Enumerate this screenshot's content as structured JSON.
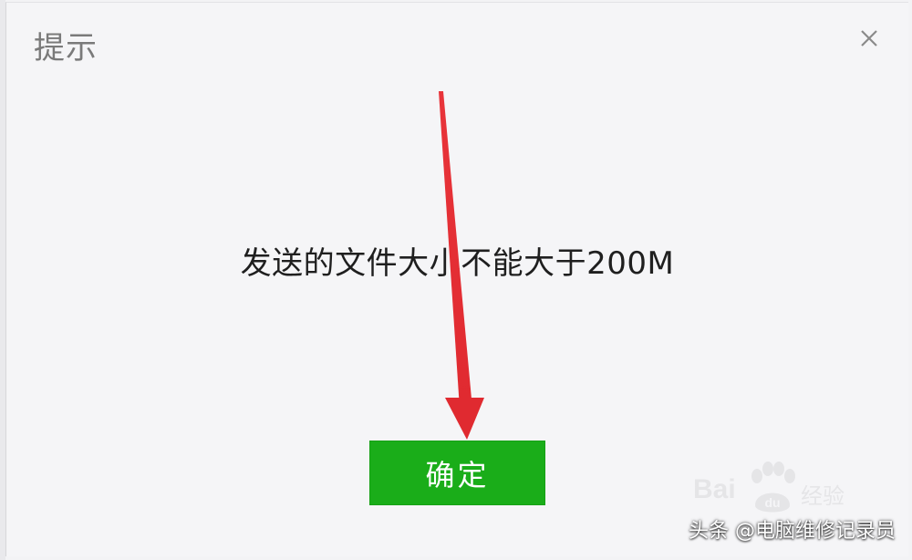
{
  "dialog": {
    "title": "提示",
    "message": "发送的文件大小不能大于200M",
    "confirm_label": "确定",
    "close_icon": "close-icon"
  },
  "watermark": {
    "brand_text": "Bai",
    "brand_suffix": "经验"
  },
  "credit": {
    "text": "头条 @电脑维修记录员"
  },
  "colors": {
    "confirm_bg": "#1aad19",
    "arrow": "#e8343a",
    "dialog_bg": "#f5f5f7"
  }
}
